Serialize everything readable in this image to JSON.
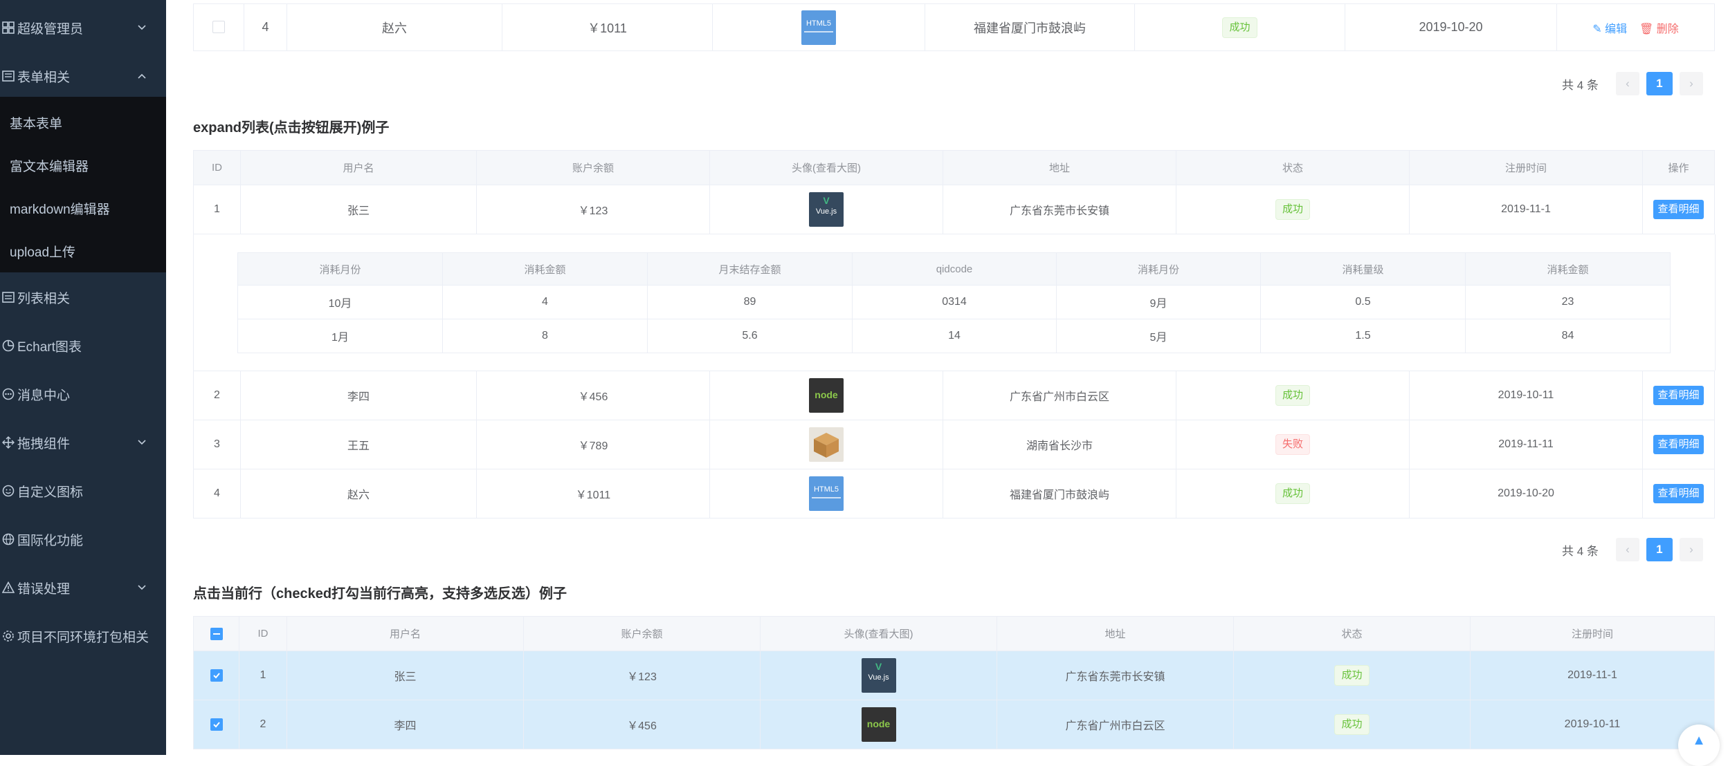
{
  "sidebar": {
    "items": [
      {
        "label": "超级管理员",
        "icon": "admin-icon",
        "arrow": "down"
      },
      {
        "label": "表单相关",
        "icon": "form-icon",
        "arrow": "up"
      },
      {
        "label": "列表相关",
        "icon": "list-icon",
        "arrow": ""
      },
      {
        "label": "Echart图表",
        "icon": "chart-icon",
        "arrow": ""
      },
      {
        "label": "消息中心",
        "icon": "message-icon",
        "arrow": ""
      },
      {
        "label": "拖拽组件",
        "icon": "drag-icon",
        "arrow": "down"
      },
      {
        "label": "自定义图标",
        "icon": "smile-icon",
        "arrow": ""
      },
      {
        "label": "国际化功能",
        "icon": "globe-icon",
        "arrow": ""
      },
      {
        "label": "错误处理",
        "icon": "warning-icon",
        "arrow": "down"
      },
      {
        "label": "项目不同环境打包相关",
        "icon": "settings-icon",
        "arrow": ""
      }
    ],
    "form_submenu": [
      "基本表单",
      "富文本编辑器",
      "markdown编辑器",
      "upload上传"
    ]
  },
  "top_table": {
    "row": {
      "id": "4",
      "name": "赵六",
      "balance": "￥1011",
      "avatar": "HTML5",
      "address": "福建省厦门市鼓浪屿",
      "status": "成功",
      "date": "2019-10-20",
      "edit": "编辑",
      "delete": "删除"
    },
    "pager": {
      "total": "共 4 条",
      "page": "1"
    }
  },
  "expand_section": {
    "title": "expand列表(点击按钮展开)例子",
    "headers": [
      "ID",
      "用户名",
      "账户余额",
      "头像(查看大图)",
      "地址",
      "状态",
      "注册时间",
      "操作"
    ],
    "rows": [
      {
        "id": "1",
        "name": "张三",
        "balance": "￥123",
        "avatar": "Vue.js",
        "address": "广东省东莞市长安镇",
        "status": "成功",
        "date": "2019-11-1",
        "action": "查看明细"
      },
      {
        "id": "2",
        "name": "李四",
        "balance": "￥456",
        "avatar": "node",
        "address": "广东省广州市白云区",
        "status": "成功",
        "date": "2019-10-11",
        "action": "查看明细"
      },
      {
        "id": "3",
        "name": "王五",
        "balance": "￥789",
        "avatar": "box",
        "address": "湖南省长沙市",
        "status": "失败",
        "date": "2019-11-11",
        "action": "查看明细"
      },
      {
        "id": "4",
        "name": "赵六",
        "balance": "￥1011",
        "avatar": "HTML5",
        "address": "福建省厦门市鼓浪屿",
        "status": "成功",
        "date": "2019-10-20",
        "action": "查看明细"
      }
    ],
    "detail": {
      "headers": [
        "消耗月份",
        "消耗金额",
        "月末结存金额",
        "qidcode",
        "消耗月份",
        "消耗量级",
        "消耗金额"
      ],
      "rows": [
        [
          "10月",
          "4",
          "89",
          "0314",
          "9月",
          "0.5",
          "23"
        ],
        [
          "1月",
          "8",
          "5.6",
          "14",
          "5月",
          "1.5",
          "84"
        ]
      ]
    },
    "pager": {
      "total": "共 4 条",
      "page": "1"
    }
  },
  "select_section": {
    "title": "点击当前行（checked打勾当前行高亮，支持多选反选）例子",
    "headers": [
      "ID",
      "用户名",
      "账户余额",
      "头像(查看大图)",
      "地址",
      "状态",
      "注册时间"
    ],
    "rows": [
      {
        "id": "1",
        "name": "张三",
        "balance": "￥123",
        "avatar": "Vue.js",
        "address": "广东省东莞市长安镇",
        "status": "成功",
        "date": "2019-11-1"
      },
      {
        "id": "2",
        "name": "李四",
        "balance": "￥456",
        "avatar": "node",
        "address": "广东省广州市白云区",
        "status": "成功",
        "date": "2019-10-11"
      }
    ]
  },
  "colors": {
    "sidebar": "#1f2d3d",
    "submenu": "#0f1115",
    "primary": "#409eff",
    "success": "#67c23a",
    "danger": "#f56c6c",
    "highlight": "#d7ecfb"
  }
}
